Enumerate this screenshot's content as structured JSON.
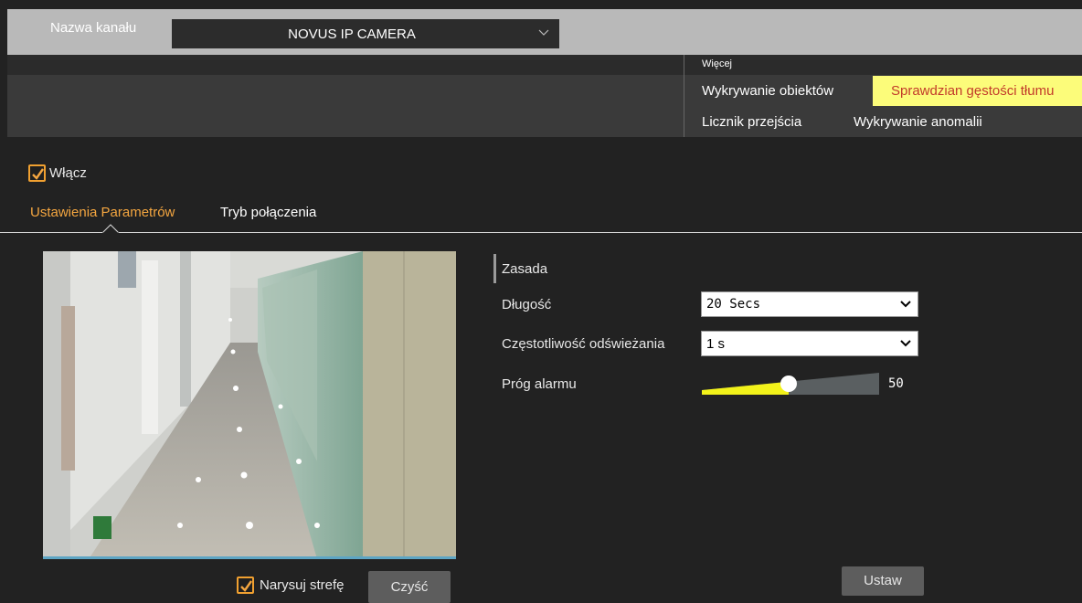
{
  "header": {
    "channel_label": "Nazwa kanału",
    "channel_value": "NOVUS IP CAMERA"
  },
  "functions": {
    "more_label": "Więcej",
    "items": [
      {
        "label": "Wykrywanie obiektów",
        "active": false
      },
      {
        "label": "Sprawdzian gęstości tłumu",
        "active": true
      },
      {
        "label": "Licznik przejścia",
        "active": false
      },
      {
        "label": "Wykrywanie anomalii",
        "active": false
      }
    ]
  },
  "enable": {
    "label": "Włącz",
    "checked": true
  },
  "tabs": [
    {
      "label": "Ustawienia Parametrów",
      "active": true
    },
    {
      "label": "Tryb połączenia",
      "active": false
    }
  ],
  "settings": {
    "section_title": "Zasada",
    "duration": {
      "label": "Długość",
      "value": "20 Secs"
    },
    "refresh": {
      "label": "Częstotliwość odświeżania",
      "value": "1 s"
    },
    "threshold": {
      "label": "Próg alarmu",
      "value": "50",
      "level": 0.5
    }
  },
  "draw_zone": {
    "label": "Narysuj strefę",
    "checked": true
  },
  "buttons": {
    "clear": "Czyść",
    "apply": "Ustaw"
  },
  "colors": {
    "accent": "#f4a640",
    "active_tab_bg": "#fcfc7a",
    "active_tab_text": "#c23a2a",
    "slider_fill": "#f2f21a"
  }
}
